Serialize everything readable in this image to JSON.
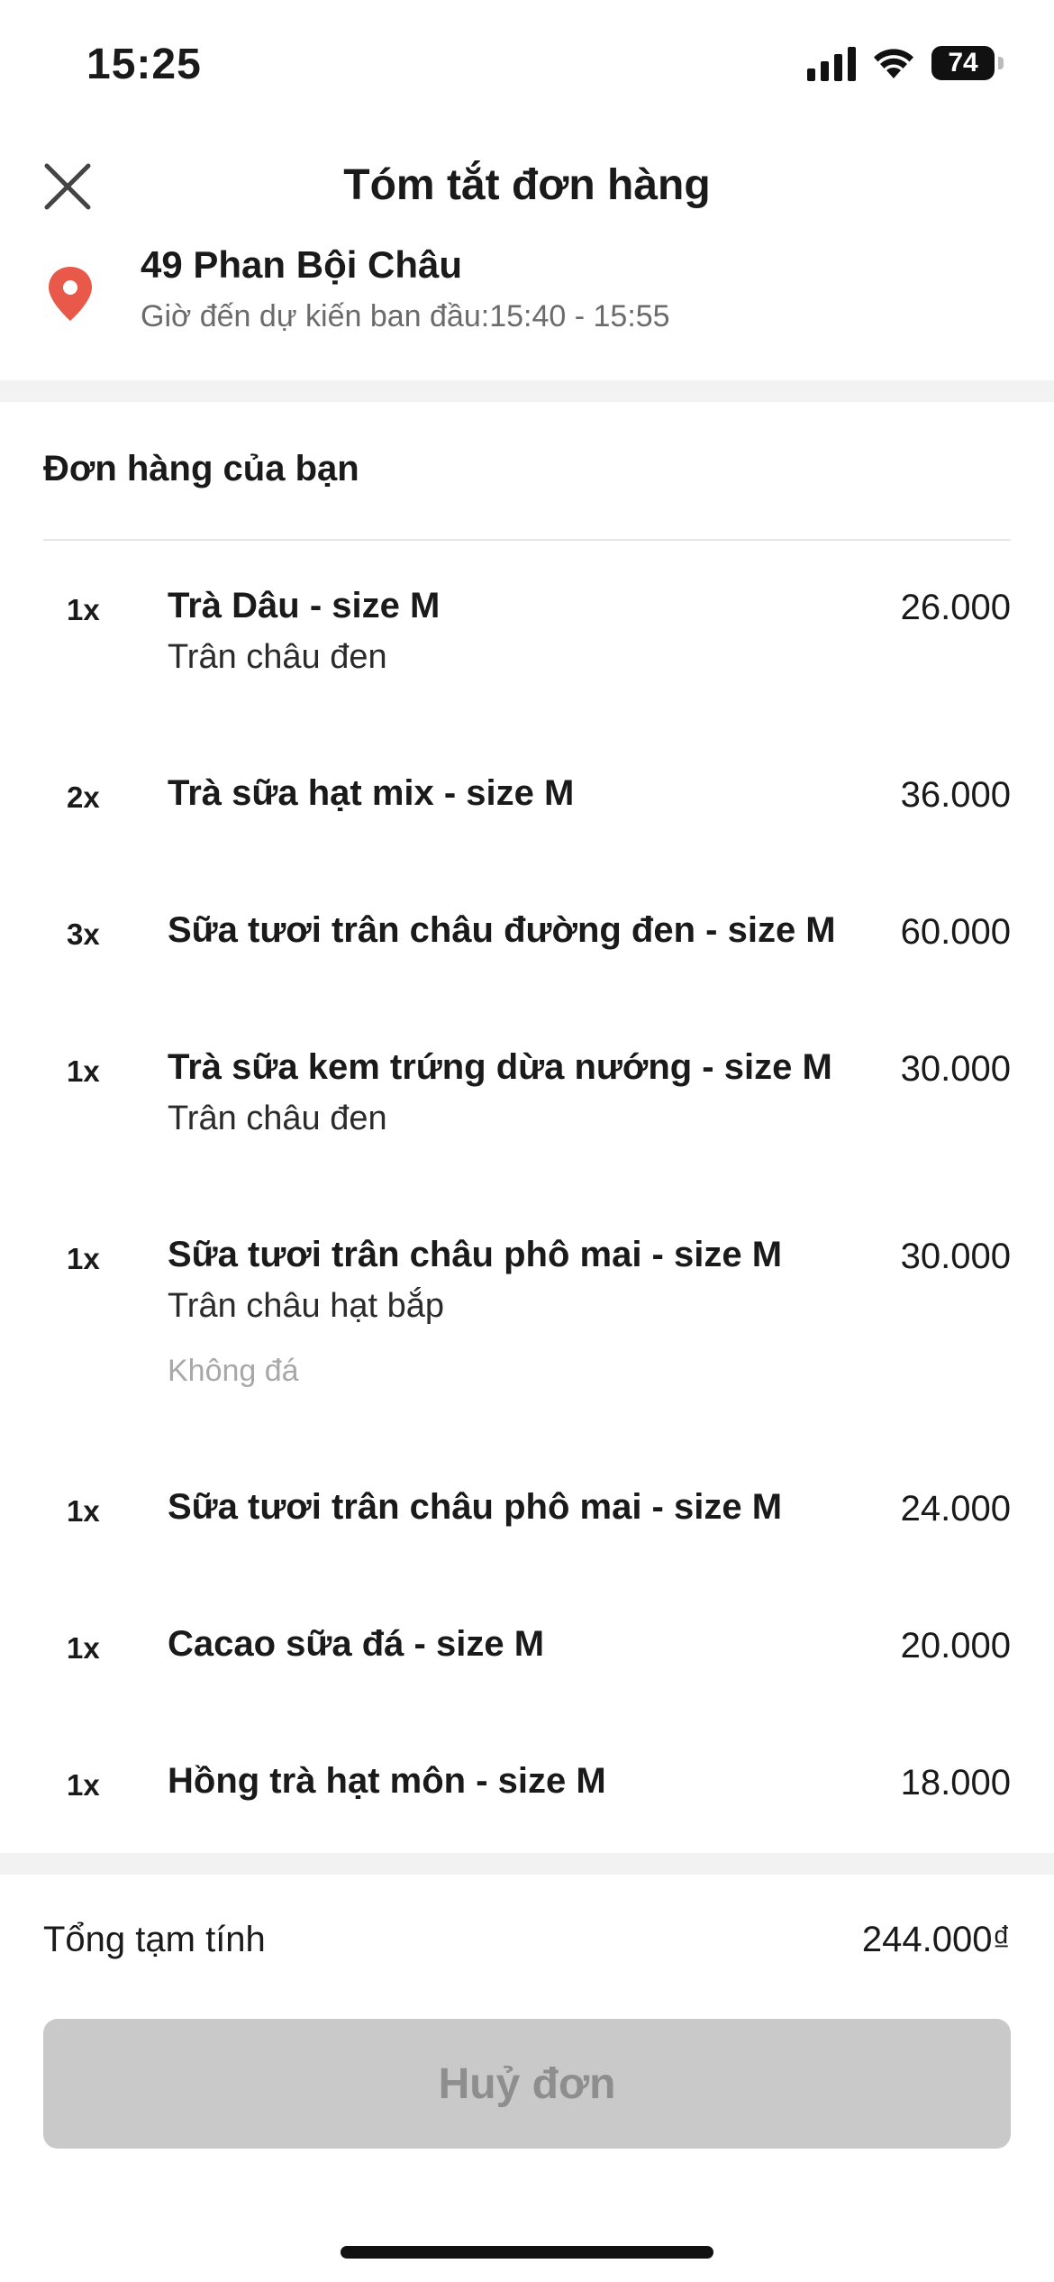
{
  "status_bar": {
    "time": "15:25",
    "battery": "74"
  },
  "header": {
    "title": "Tóm tắt đơn hàng"
  },
  "address": {
    "title": "49 Phan Bội Châu",
    "subtitle": "Giờ đến dự kiến ban đầu:15:40 - 15:55"
  },
  "order": {
    "section_title": "Đơn hàng của bạn",
    "items": [
      {
        "qty": "1x",
        "name": "Trà Dâu - size M",
        "price": "26.000",
        "option": "Trân châu đen",
        "note": ""
      },
      {
        "qty": "2x",
        "name": "Trà sữa hạt mix - size M",
        "price": "36.000",
        "option": "",
        "note": ""
      },
      {
        "qty": "3x",
        "name": "Sữa tươi trân châu đường đen - size M",
        "price": "60.000",
        "option": "",
        "note": ""
      },
      {
        "qty": "1x",
        "name": "Trà sữa kem trứng dừa nướng - size M",
        "price": "30.000",
        "option": "Trân châu đen",
        "note": ""
      },
      {
        "qty": "1x",
        "name": "Sữa tươi trân châu phô mai - size M",
        "price": "30.000",
        "option": "Trân châu hạt bắp",
        "note": "Không đá"
      },
      {
        "qty": "1x",
        "name": "Sữa tươi trân châu phô mai - size M",
        "price": "24.000",
        "option": "",
        "note": ""
      },
      {
        "qty": "1x",
        "name": "Cacao sữa đá - size M",
        "price": "20.000",
        "option": "",
        "note": ""
      },
      {
        "qty": "1x",
        "name": "Hồng trà hạt môn - size M",
        "price": "18.000",
        "option": "",
        "note": ""
      }
    ]
  },
  "summary": {
    "subtotal_label": "Tổng tạm tính",
    "subtotal_value": "244.000₫"
  },
  "actions": {
    "cancel_label": "Huỷ đơn"
  },
  "colors": {
    "pin": "#e8594a",
    "button_bg": "#c9c9c9",
    "button_text": "#8e8e8e"
  }
}
